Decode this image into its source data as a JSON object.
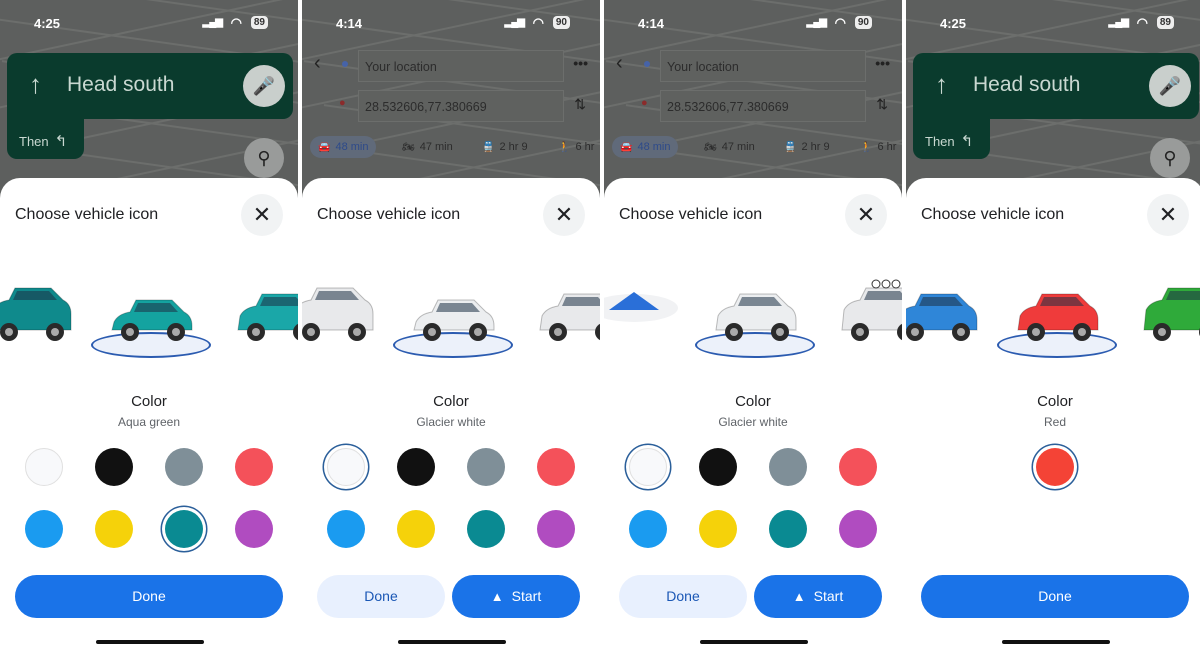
{
  "accent": "#1a73e8",
  "panels": [
    {
      "status": {
        "time": "4:25",
        "battery": "89"
      },
      "header": {
        "type": "navigation",
        "instruction": "Head south",
        "then_label": "Then"
      },
      "sheet": {
        "title": "Choose vehicle icon"
      },
      "vehicles": [
        {
          "kind": "suv",
          "color": "#0f8a8c",
          "selected": false
        },
        {
          "kind": "sports",
          "color": "#14a3a0",
          "selected": true
        },
        {
          "kind": "hatch",
          "color": "#1aa7a8",
          "selected": false
        }
      ],
      "color_label": "Color",
      "color_name": "Aqua green",
      "swatches": [
        {
          "name": "white",
          "hex": "#f8f9fb",
          "selected": false
        },
        {
          "name": "black",
          "hex": "#111111",
          "selected": false
        },
        {
          "name": "gray",
          "hex": "#7f8f98",
          "selected": false
        },
        {
          "name": "red",
          "hex": "#f4515a",
          "selected": false
        },
        {
          "name": "blue",
          "hex": "#1a9bf0",
          "selected": false
        },
        {
          "name": "yellow",
          "hex": "#f5d20a",
          "selected": false
        },
        {
          "name": "teal",
          "hex": "#0a8a92",
          "selected": true
        },
        {
          "name": "purple",
          "hex": "#b04cc0",
          "selected": false
        }
      ],
      "buttons": [
        {
          "label": "Done",
          "style": "primary"
        }
      ]
    },
    {
      "status": {
        "time": "4:14",
        "battery": "90"
      },
      "header": {
        "type": "route",
        "origin": "Your location",
        "destination": "28.532606,77.380669",
        "modes": [
          {
            "icon": "car-icon",
            "label": "48 min",
            "selected": true
          },
          {
            "icon": "motorbike-icon",
            "label": "47 min"
          },
          {
            "icon": "transit-icon",
            "label": "2 hr 9"
          },
          {
            "icon": "walk-icon",
            "label": "6 hr"
          }
        ]
      },
      "sheet": {
        "title": "Choose vehicle icon"
      },
      "vehicles": [
        {
          "kind": "suv",
          "color": "#e8e9eb",
          "selected": false
        },
        {
          "kind": "sports",
          "color": "#eceef0",
          "selected": true
        },
        {
          "kind": "hatch",
          "color": "#e8e9eb",
          "selected": false
        }
      ],
      "color_label": "Color",
      "color_name": "Glacier white",
      "swatches": [
        {
          "name": "white",
          "hex": "#f8f9fb",
          "selected": true
        },
        {
          "name": "black",
          "hex": "#111111",
          "selected": false
        },
        {
          "name": "gray",
          "hex": "#7f8f98",
          "selected": false
        },
        {
          "name": "red",
          "hex": "#f4515a",
          "selected": false
        },
        {
          "name": "blue",
          "hex": "#1a9bf0",
          "selected": false
        },
        {
          "name": "yellow",
          "hex": "#f5d20a",
          "selected": false
        },
        {
          "name": "teal",
          "hex": "#0a8a92",
          "selected": false
        },
        {
          "name": "purple",
          "hex": "#b04cc0",
          "selected": false
        }
      ],
      "buttons": [
        {
          "label": "Done",
          "style": "light"
        },
        {
          "label": "Start",
          "style": "primary",
          "icon": "navigation-arrow-icon"
        }
      ]
    },
    {
      "status": {
        "time": "4:14",
        "battery": "90"
      },
      "header": {
        "type": "route",
        "origin": "Your location",
        "destination": "28.532606,77.380669",
        "modes": [
          {
            "icon": "car-icon",
            "label": "48 min",
            "selected": true
          },
          {
            "icon": "motorbike-icon",
            "label": "47 min"
          },
          {
            "icon": "transit-icon",
            "label": "2 hr 9"
          },
          {
            "icon": "walk-icon",
            "label": "6 hr"
          }
        ]
      },
      "sheet": {
        "title": "Choose vehicle icon"
      },
      "vehicles": [
        {
          "kind": "arrow",
          "color": "#2a6fd8",
          "selected": false
        },
        {
          "kind": "sedan",
          "color": "#eceef0",
          "selected": true
        },
        {
          "kind": "offroad",
          "color": "#e8e9eb",
          "selected": false
        }
      ],
      "color_label": "Color",
      "color_name": "Glacier white",
      "swatches": [
        {
          "name": "white",
          "hex": "#f8f9fb",
          "selected": true
        },
        {
          "name": "black",
          "hex": "#111111",
          "selected": false
        },
        {
          "name": "gray",
          "hex": "#7f8f98",
          "selected": false
        },
        {
          "name": "red",
          "hex": "#f4515a",
          "selected": false
        },
        {
          "name": "blue",
          "hex": "#1a9bf0",
          "selected": false
        },
        {
          "name": "yellow",
          "hex": "#f5d20a",
          "selected": false
        },
        {
          "name": "teal",
          "hex": "#0a8a92",
          "selected": false
        },
        {
          "name": "purple",
          "hex": "#b04cc0",
          "selected": false
        }
      ],
      "buttons": [
        {
          "label": "Done",
          "style": "light"
        },
        {
          "label": "Start",
          "style": "primary",
          "icon": "navigation-arrow-icon"
        }
      ]
    },
    {
      "status": {
        "time": "4:25",
        "battery": "89"
      },
      "header": {
        "type": "navigation",
        "instruction": "Head south",
        "then_label": "Then"
      },
      "sheet": {
        "title": "Choose vehicle icon"
      },
      "vehicles": [
        {
          "kind": "hatch",
          "color": "#2f86d8",
          "selected": false
        },
        {
          "kind": "sedan",
          "color": "#ef3b3b",
          "selected": true
        },
        {
          "kind": "truck",
          "color": "#2faa3a",
          "selected": false
        }
      ],
      "color_label": "Color",
      "color_name": "Red",
      "swatches": [
        {
          "name": "red",
          "hex": "#f44336",
          "selected": true
        }
      ],
      "buttons": [
        {
          "label": "Done",
          "style": "primary"
        }
      ]
    }
  ]
}
